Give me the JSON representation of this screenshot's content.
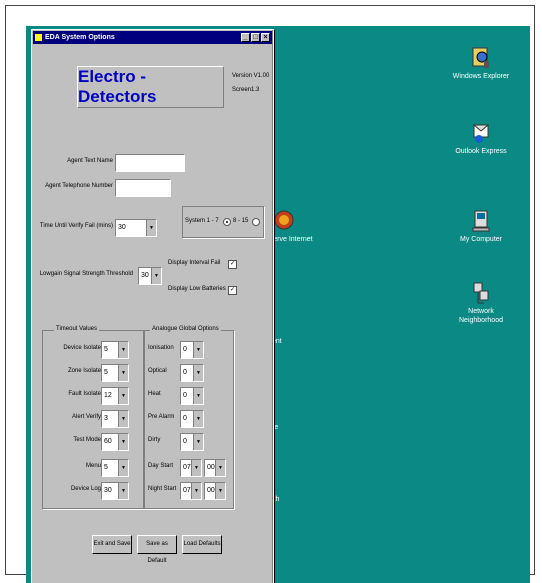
{
  "window": {
    "title": "EDA System Options",
    "brand": "Electro - Detectors",
    "version": "Version V1.00",
    "screen": "Screen1.3",
    "buttons": {
      "minimize": "_",
      "maximize": "□",
      "close": "×"
    }
  },
  "fields": {
    "agent_text_name": {
      "label": "Agent Text Name",
      "value": ""
    },
    "agent_telephone_number": {
      "label": "Agent Telephone Number",
      "value": ""
    },
    "time_until_verify_fail": {
      "label": "Time Until Verify Fail (mins)",
      "value": "30"
    },
    "system": {
      "label": "System 1 - 7",
      "option2": "8 - 15",
      "selected": "System 1 - 7"
    },
    "lowgain_signal": {
      "label": "Lowgain Signal Strength Threshold",
      "value": "30"
    },
    "display_interval_fail": {
      "label": "Display Interval Fail",
      "checked": true
    },
    "display_low_batteries": {
      "label": "Display Low Batteries",
      "checked": true
    }
  },
  "timeout_values": {
    "title": "Timeout Values",
    "rows": [
      {
        "label": "Device Isolate",
        "value": "5"
      },
      {
        "label": "Zone Isolate",
        "value": "5"
      },
      {
        "label": "Fault Isolate",
        "value": "12"
      },
      {
        "label": "Alert Verify",
        "value": "3"
      },
      {
        "label": "Test Mode",
        "value": "60"
      },
      {
        "label": "Menu",
        "value": "5"
      },
      {
        "label": "Device Log",
        "value": "30"
      }
    ]
  },
  "analogue_options": {
    "title": "Analogue Global Options",
    "rows": [
      {
        "label": "Ionisation",
        "value": "0"
      },
      {
        "label": "Optical",
        "value": "0"
      },
      {
        "label": "Heat",
        "value": "0"
      },
      {
        "label": "Pre Alarm",
        "value": "0"
      },
      {
        "label": "Dirty",
        "value": "0"
      }
    ],
    "day_start": {
      "label": "Day Start",
      "hour": "07",
      "minute": "00"
    },
    "night_start": {
      "label": "Night Start",
      "hour": "07",
      "minute": "00"
    }
  },
  "actions": {
    "exit_save": "Exit and Save",
    "save_default": "Save as Default",
    "load_defaults": "Load Defaults"
  },
  "desktop": {
    "icons": [
      {
        "label": "Windows Explorer",
        "icon": "explorer-icon"
      },
      {
        "label": "Outlook Express",
        "icon": "outlook-icon"
      },
      {
        "label": "My Computer",
        "icon": "computer-icon"
      },
      {
        "label": "Network Neighborhood",
        "icon": "network-icon"
      },
      {
        "label": "Freeserve Internet",
        "icon": "freeserve-icon"
      }
    ],
    "partial_labels": [
      "ent",
      "re",
      "ith"
    ]
  },
  "colors": {
    "desktop": "#0b8a85",
    "title_bar": "#00007f",
    "brand_text": "#0000c0"
  }
}
